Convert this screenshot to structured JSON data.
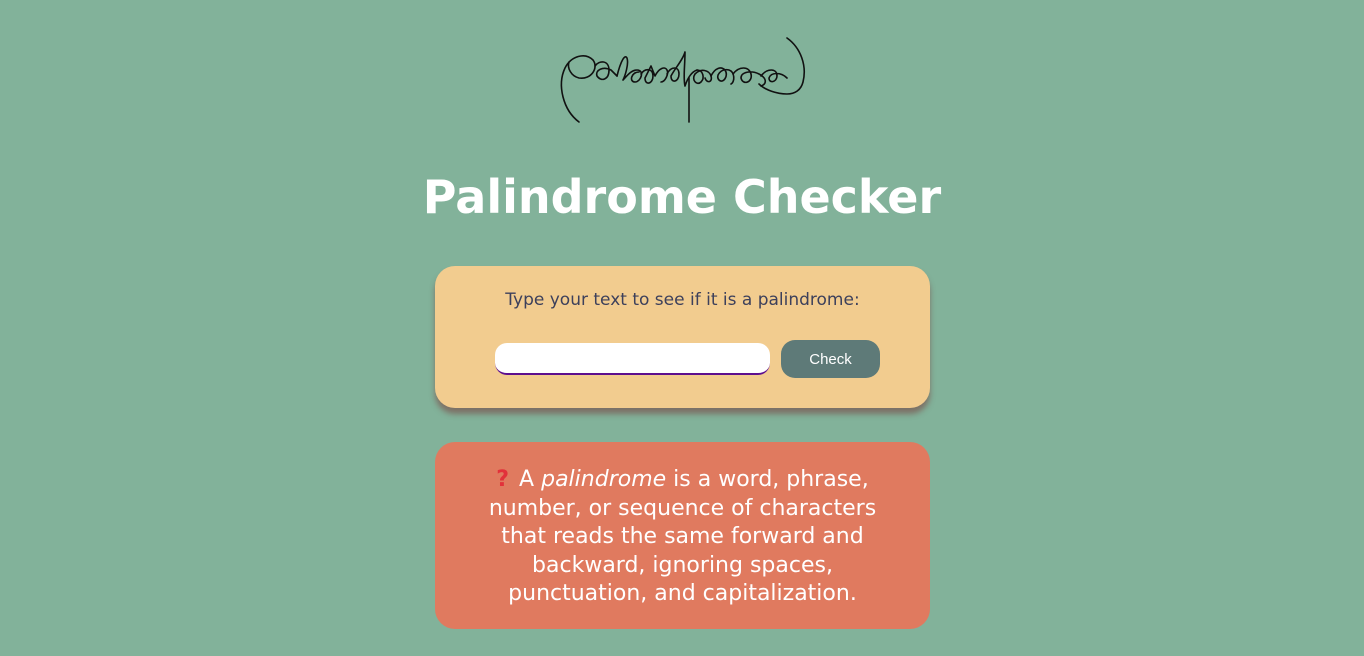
{
  "logo": {
    "text": "palindrome"
  },
  "page": {
    "title": "Palindrome Checker"
  },
  "checker": {
    "label": "Type your text to see if it is a palindrome:",
    "input_value": "",
    "button_label": "Check"
  },
  "info": {
    "icon": "question-mark-icon",
    "icon_glyph": "?",
    "prefix": "A",
    "emphasis": "palindrome",
    "body": "is a word, phrase, number, or sequence of characters that reads the same forward and backward, ignoring spaces, punctuation, and capitalization."
  },
  "colors": {
    "background": "#82b29a",
    "title": "#ffffff",
    "input_card": "#f2cc8f",
    "input_label": "#3d405b",
    "button": "#5e7a78",
    "info_card": "#e07a5f",
    "icon": "#e2313a"
  }
}
